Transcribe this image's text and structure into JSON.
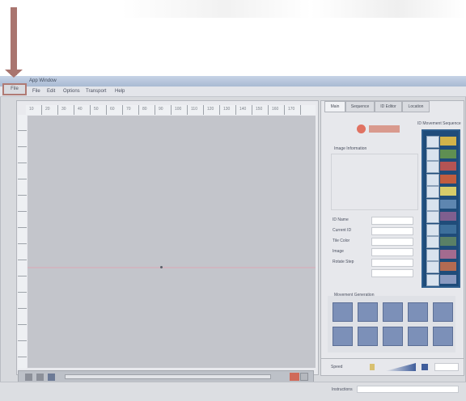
{
  "title_bar": {
    "title": "App Window"
  },
  "file_menu_highlight": {
    "label": "File"
  },
  "menu": [
    "File",
    "Edit",
    "Options",
    "Transport",
    "Help"
  ],
  "ruler": {
    "marks": [
      "10",
      "20",
      "30",
      "40",
      "50",
      "60",
      "70",
      "80",
      "90",
      "100",
      "110",
      "120",
      "130",
      "140",
      "150",
      "160",
      "170"
    ]
  },
  "right_panel": {
    "tabs": [
      "Main",
      "Sequence",
      "ID Editor",
      "Location"
    ],
    "shapes_header": "ID Movement Sequence",
    "image_info_label": "Image Information",
    "fields": [
      "ID Name",
      "Current ID",
      "Tile Color",
      "Image",
      "Rotate Step"
    ],
    "movement_label": "Movement Generation",
    "bottom_label": "Speed",
    "footer_label": "Instructions"
  },
  "palette_colors": [
    "#d2b34a",
    "#5f8f52",
    "#b45454",
    "#c25d3f",
    "#d7cc6a",
    "#5e86b0",
    "#7f5f8f",
    "#3d6f9b",
    "#5a8066",
    "#a46b8f",
    "#b36b52",
    "#8a9ac0"
  ],
  "colors": {
    "accent_red": "#e07262",
    "palette_bg": "#1f4c7a",
    "arrow": "#a9756f"
  }
}
